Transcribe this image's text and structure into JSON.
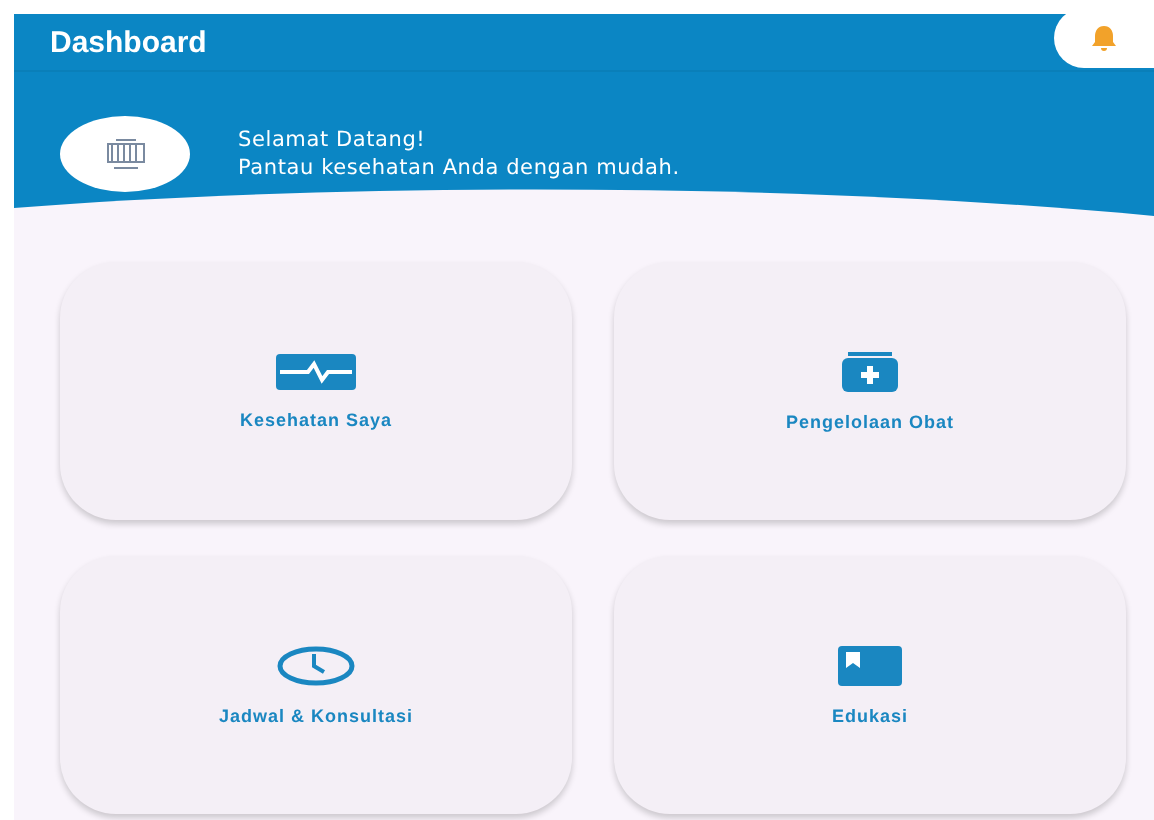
{
  "app_bar": {
    "title": "Dashboard"
  },
  "welcome": {
    "heading": "Selamat Datang!",
    "subtitle": "Pantau kesehatan Anda dengan mudah."
  },
  "menu_cards": [
    {
      "label": "Kesehatan Saya"
    },
    {
      "label": "Pengelolaan Obat"
    },
    {
      "label": "Jadwal & Konsultasi"
    },
    {
      "label": "Edukasi"
    }
  ]
}
